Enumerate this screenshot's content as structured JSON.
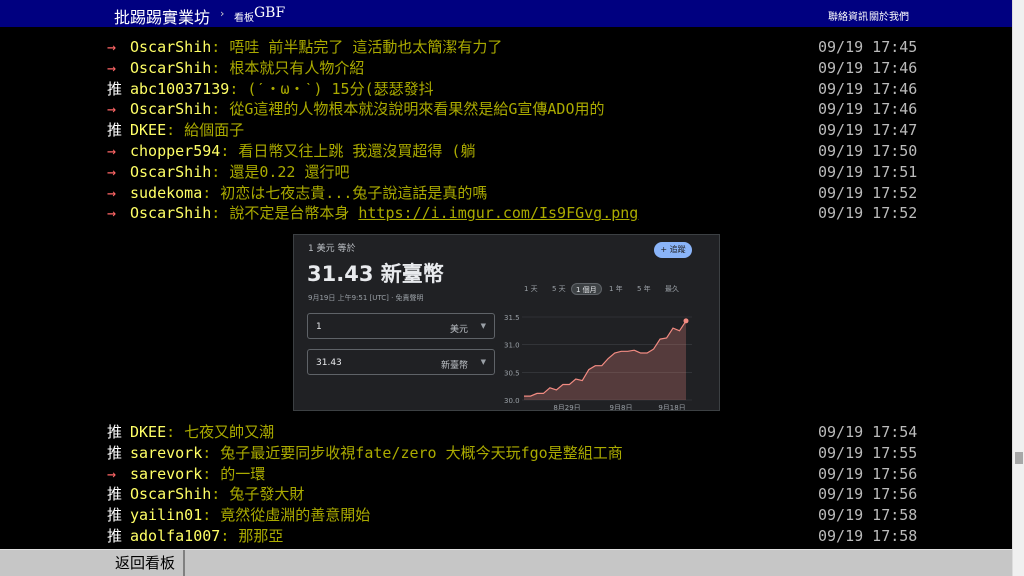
{
  "header": {
    "site_title": "批踢踢實業坊",
    "breadcrumb_separator": "›",
    "board_label": "看板",
    "board_name": "GBF",
    "links": {
      "contact": "聯絡資訊",
      "about": "關於我們"
    }
  },
  "pushes_top": [
    {
      "tag": "→",
      "user": "OscarShih",
      "content": ": 唔哇 前半點完了 這活動也太簡潔有力了",
      "datetime": "09/19 17:45"
    },
    {
      "tag": "→",
      "user": "OscarShih",
      "content": ": 根本就只有人物介紹",
      "datetime": "09/19 17:46"
    },
    {
      "tag": "推",
      "user": "abc10037139",
      "content": ": (ˊ・ω・ˋ) 15分(瑟瑟發抖",
      "datetime": "09/19 17:46"
    },
    {
      "tag": "→",
      "user": "OscarShih",
      "content": ": 從G這裡的人物根本就沒說明來看果然是給G宣傳ADO用的",
      "datetime": "09/19 17:46"
    },
    {
      "tag": "推",
      "user": "DKEE",
      "content": ": 給個面子",
      "datetime": "09/19 17:47"
    },
    {
      "tag": "→",
      "user": "chopper594",
      "content": ": 看日幣又往上跳  我還沒買超得 (躺",
      "datetime": "09/19 17:50"
    },
    {
      "tag": "→",
      "user": "OscarShih",
      "content": ": 還是0.22 還行吧",
      "datetime": "09/19 17:51"
    },
    {
      "tag": "→",
      "user": "sudekoma",
      "content": ": 初恋は七夜志貴...兔子說這話是真的嗎",
      "datetime": "09/19 17:52"
    },
    {
      "tag": "→",
      "user": "OscarShih",
      "content_prefix": ": 說不定是台幣本身 ",
      "link": "https://i.imgur.com/Is9FGvg.png",
      "datetime": "09/19 17:52"
    }
  ],
  "pushes_bottom": [
    {
      "tag": "推",
      "user": "DKEE",
      "content": ": 七夜又帥又潮",
      "datetime": "09/19 17:54"
    },
    {
      "tag": "推",
      "user": "sarevork",
      "content": ": 兔子最近要同步收視fate/zero 大概今天玩fgo是整組工商",
      "datetime": "09/19 17:55"
    },
    {
      "tag": "→",
      "user": "sarevork",
      "content": ": 的一環",
      "datetime": "09/19 17:56"
    },
    {
      "tag": "推",
      "user": "OscarShih",
      "content": ": 兔子發大財",
      "datetime": "09/19 17:56"
    },
    {
      "tag": "推",
      "user": "yailin01",
      "content": ": 竟然從虛淵的善意開始",
      "datetime": "09/19 17:58"
    },
    {
      "tag": "推",
      "user": "adolfa1007",
      "content": ": 那那亞",
      "datetime": "09/19 17:58"
    }
  ],
  "image_preview": {
    "header": "1 美元 等於",
    "value": "31.43 新臺幣",
    "timestamp": "9月19日 上午9:51 [UTC] · 免責聲明",
    "follow_button": "+ 追蹤",
    "from": {
      "amount": "1",
      "currency": "美元"
    },
    "to": {
      "amount": "31.43",
      "currency": "新臺幣"
    },
    "ranges": [
      "1 天",
      "5 天",
      "1 個月",
      "1 年",
      "5 年",
      "最久"
    ],
    "active_range": "1 個月",
    "accent_color": "#f28b82",
    "chart_data": {
      "type": "area",
      "y_ticks": [
        "31.5",
        "31.0",
        "30.5",
        "30.0"
      ],
      "ylim": [
        30.0,
        31.5
      ],
      "x_ticks": [
        "8月29日",
        "9月8日",
        "9月18日"
      ],
      "values": [
        30.07,
        30.07,
        30.12,
        30.12,
        30.22,
        30.18,
        30.28,
        30.28,
        30.38,
        30.35,
        30.55,
        30.62,
        30.62,
        30.75,
        30.85,
        30.88,
        30.88,
        30.9,
        30.85,
        30.85,
        30.92,
        31.1,
        31.12,
        31.3,
        31.25,
        31.43
      ]
    }
  },
  "footer": {
    "back": "返回看板"
  }
}
